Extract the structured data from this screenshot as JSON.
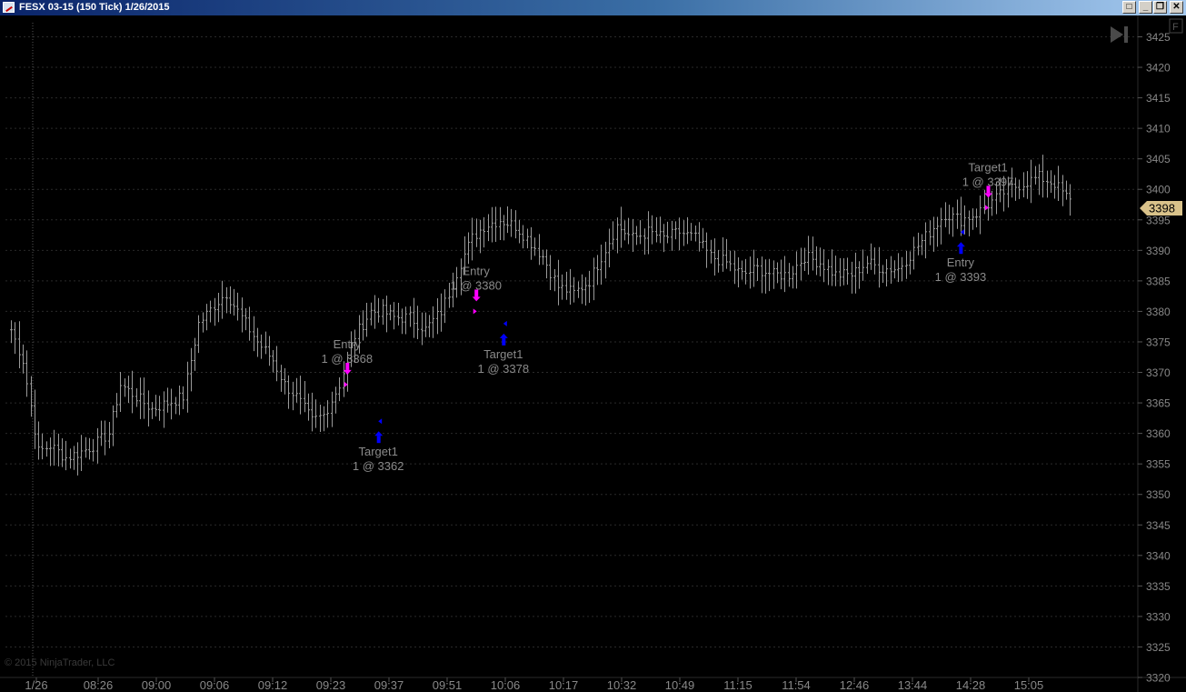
{
  "window": {
    "title": "FESX 03-15 (150 Tick)  1/26/2015",
    "buttons": [
      "□",
      "_",
      "❐",
      "✕"
    ]
  },
  "chart_panel": {
    "f_button": "F",
    "scroll_end_icon": "skip-to-end-icon",
    "copyright": "© 2015 NinjaTrader, LLC",
    "last_price": "3398",
    "colors": {
      "background": "#000000",
      "bar": "#9a9a9a",
      "grid": "#2a2a2a",
      "sell": "#ff00ff",
      "buy": "#0000ff",
      "price_marker": "#d9c28a"
    }
  },
  "chart_data": {
    "type": "ohlc",
    "instrument": "FESX 03-15",
    "period": "150 Tick",
    "date": "1/26/2015",
    "ylim": [
      3320,
      3428
    ],
    "y_ticks": [
      3425,
      3420,
      3415,
      3410,
      3405,
      3400,
      3395,
      3390,
      3385,
      3380,
      3375,
      3370,
      3365,
      3360,
      3355,
      3350,
      3345,
      3340,
      3335,
      3330,
      3325,
      3320
    ],
    "x_ticks": [
      "1/26",
      "08:26",
      "09:00",
      "09:06",
      "09:12",
      "09:23",
      "09:37",
      "09:51",
      "10:06",
      "10:17",
      "10:32",
      "10:49",
      "11:15",
      "11:54",
      "12:46",
      "13:44",
      "14:28",
      "15:05"
    ],
    "grid": true,
    "last_price": 3398,
    "close_path": [
      [
        0,
        3377
      ],
      [
        3,
        3372
      ],
      [
        7,
        3357
      ],
      [
        10,
        3358
      ],
      [
        14,
        3356
      ],
      [
        18,
        3357
      ],
      [
        21,
        3358
      ],
      [
        25,
        3360
      ],
      [
        28,
        3368
      ],
      [
        32,
        3366
      ],
      [
        36,
        3364
      ],
      [
        40,
        3365
      ],
      [
        44,
        3366
      ],
      [
        48,
        3378
      ],
      [
        52,
        3381
      ],
      [
        55,
        3383
      ],
      [
        59,
        3379
      ],
      [
        63,
        3375
      ],
      [
        67,
        3372
      ],
      [
        70,
        3368
      ],
      [
        73,
        3366
      ],
      [
        77,
        3362
      ],
      [
        80,
        3363
      ],
      [
        84,
        3368
      ],
      [
        88,
        3376
      ],
      [
        92,
        3380
      ],
      [
        95,
        3380
      ],
      [
        98,
        3379
      ],
      [
        102,
        3379
      ],
      [
        106,
        3377
      ],
      [
        110,
        3380
      ],
      [
        112,
        3383
      ],
      [
        115,
        3388
      ],
      [
        118,
        3392
      ],
      [
        121,
        3394
      ],
      [
        125,
        3395
      ],
      [
        129,
        3394
      ],
      [
        132,
        3392
      ],
      [
        136,
        3389
      ],
      [
        140,
        3384
      ],
      [
        144,
        3383
      ],
      [
        148,
        3385
      ],
      [
        151,
        3389
      ],
      [
        155,
        3394
      ],
      [
        159,
        3392
      ],
      [
        163,
        3393
      ],
      [
        167,
        3392
      ],
      [
        171,
        3393
      ],
      [
        175,
        3392
      ],
      [
        179,
        3389
      ],
      [
        183,
        3388
      ],
      [
        187,
        3386
      ],
      [
        191,
        3387
      ],
      [
        195,
        3386
      ],
      [
        199,
        3386
      ],
      [
        203,
        3389
      ],
      [
        207,
        3388
      ],
      [
        211,
        3386
      ],
      [
        215,
        3386
      ],
      [
        219,
        3388
      ],
      [
        223,
        3387
      ],
      [
        227,
        3387
      ],
      [
        231,
        3390
      ],
      [
        235,
        3393
      ],
      [
        239,
        3396
      ],
      [
        243,
        3395
      ],
      [
        247,
        3396
      ],
      [
        251,
        3398
      ],
      [
        255,
        3400
      ],
      [
        259,
        3401
      ],
      [
        263,
        3402
      ],
      [
        267,
        3401
      ],
      [
        271,
        3398
      ]
    ],
    "trades": [
      {
        "label": "Entry",
        "detail": "1 @ 3368",
        "side": "sell",
        "bar": 86,
        "price": 3368
      },
      {
        "label": "Target1",
        "detail": "1 @ 3362",
        "side": "buy",
        "bar": 94,
        "price": 3362
      },
      {
        "label": "Entry",
        "detail": "1 @ 3380",
        "side": "sell",
        "bar": 119,
        "price": 3380
      },
      {
        "label": "Target1",
        "detail": "1 @ 3378",
        "side": "buy",
        "bar": 126,
        "price": 3378
      },
      {
        "label": "Entry",
        "detail": "1 @ 3393",
        "side": "buy",
        "bar": 243,
        "price": 3393
      },
      {
        "label": "Target1",
        "detail": "1 @ 3397",
        "side": "sell",
        "bar": 250,
        "price": 3397
      }
    ]
  }
}
